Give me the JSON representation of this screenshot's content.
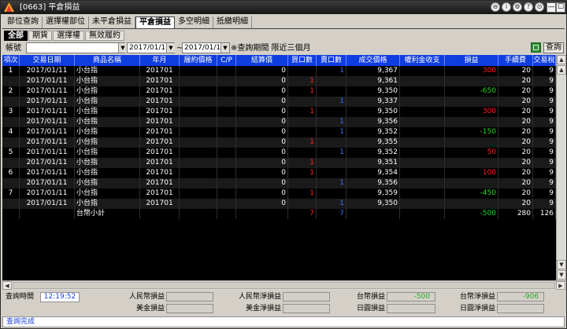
{
  "window": {
    "title": "[0663] 平倉損益",
    "title_buttons": [
      "⊖",
      "i",
      "⚙",
      "?",
      "⊙"
    ],
    "controls": [
      "—",
      "☐",
      "✕"
    ]
  },
  "tabs": [
    {
      "label": "部位查詢",
      "active": false
    },
    {
      "label": "選擇權部位",
      "active": false
    },
    {
      "label": "未平倉損益",
      "active": false
    },
    {
      "label": "平倉損益",
      "active": true
    },
    {
      "label": "多空明細",
      "active": false
    },
    {
      "label": "抵繳明細",
      "active": false
    }
  ],
  "subtabs": [
    {
      "label": "全部",
      "active": true
    },
    {
      "label": "期貨",
      "active": false
    },
    {
      "label": "選擇權",
      "active": false
    },
    {
      "label": "無效履約",
      "active": false
    }
  ],
  "filter": {
    "account_label": "帳號",
    "account_value": "",
    "date_from": "2017/01/11",
    "date_to": "2017/01/11",
    "tilde": "~",
    "note": "※查詢期間 限近三個月",
    "query_button": "查詢"
  },
  "grid": {
    "columns": [
      "項次",
      "交易日期",
      "商品名稱",
      "年月",
      "履約價格",
      "C/P",
      "結算價",
      "買口數",
      "賣口數",
      "成交價格",
      "權利金收支",
      "損益",
      "手續費",
      "交易稅"
    ],
    "rows": [
      {
        "idx": "1",
        "date": "2017/01/11",
        "name": "小台指",
        "ym": "201701",
        "strike": "",
        "cp": "",
        "settle": "0",
        "buy": "",
        "sell": "1",
        "price": "9,367",
        "premium": "",
        "pnl": "300",
        "pnl_color": "#ff2020",
        "fee": "20",
        "tax": "9"
      },
      {
        "idx": "",
        "date": "2017/01/11",
        "name": "小台指",
        "ym": "201701",
        "strike": "",
        "cp": "",
        "settle": "0",
        "buy": "1",
        "sell": "",
        "price": "9,361",
        "premium": "",
        "pnl": "",
        "pnl_color": "#ffffff",
        "fee": "20",
        "tax": "9"
      },
      {
        "idx": "2",
        "date": "2017/01/11",
        "name": "小台指",
        "ym": "201701",
        "strike": "",
        "cp": "",
        "settle": "0",
        "buy": "1",
        "sell": "",
        "price": "9,350",
        "premium": "",
        "pnl": "-650",
        "pnl_color": "#22dd22",
        "fee": "20",
        "tax": "9"
      },
      {
        "idx": "",
        "date": "2017/01/11",
        "name": "小台指",
        "ym": "201701",
        "strike": "",
        "cp": "",
        "settle": "0",
        "buy": "",
        "sell": "1",
        "price": "9,337",
        "premium": "",
        "pnl": "",
        "pnl_color": "#ffffff",
        "fee": "20",
        "tax": "9"
      },
      {
        "idx": "3",
        "date": "2017/01/11",
        "name": "小台指",
        "ym": "201701",
        "strike": "",
        "cp": "",
        "settle": "0",
        "buy": "1",
        "sell": "",
        "price": "9,350",
        "premium": "",
        "pnl": "300",
        "pnl_color": "#ff2020",
        "fee": "20",
        "tax": "9"
      },
      {
        "idx": "",
        "date": "2017/01/11",
        "name": "小台指",
        "ym": "201701",
        "strike": "",
        "cp": "",
        "settle": "0",
        "buy": "",
        "sell": "1",
        "price": "9,356",
        "premium": "",
        "pnl": "",
        "pnl_color": "#ffffff",
        "fee": "20",
        "tax": "9"
      },
      {
        "idx": "4",
        "date": "2017/01/11",
        "name": "小台指",
        "ym": "201701",
        "strike": "",
        "cp": "",
        "settle": "0",
        "buy": "",
        "sell": "1",
        "price": "9,352",
        "premium": "",
        "pnl": "-150",
        "pnl_color": "#22dd22",
        "fee": "20",
        "tax": "9"
      },
      {
        "idx": "",
        "date": "2017/01/11",
        "name": "小台指",
        "ym": "201701",
        "strike": "",
        "cp": "",
        "settle": "0",
        "buy": "1",
        "sell": "",
        "price": "9,355",
        "premium": "",
        "pnl": "",
        "pnl_color": "#ffffff",
        "fee": "20",
        "tax": "9"
      },
      {
        "idx": "5",
        "date": "2017/01/11",
        "name": "小台指",
        "ym": "201701",
        "strike": "",
        "cp": "",
        "settle": "0",
        "buy": "",
        "sell": "1",
        "price": "9,352",
        "premium": "",
        "pnl": "50",
        "pnl_color": "#ff2020",
        "fee": "20",
        "tax": "9"
      },
      {
        "idx": "",
        "date": "2017/01/11",
        "name": "小台指",
        "ym": "201701",
        "strike": "",
        "cp": "",
        "settle": "0",
        "buy": "1",
        "sell": "",
        "price": "9,351",
        "premium": "",
        "pnl": "",
        "pnl_color": "#ffffff",
        "fee": "20",
        "tax": "9"
      },
      {
        "idx": "6",
        "date": "2017/01/11",
        "name": "小台指",
        "ym": "201701",
        "strike": "",
        "cp": "",
        "settle": "0",
        "buy": "1",
        "sell": "",
        "price": "9,354",
        "premium": "",
        "pnl": "100",
        "pnl_color": "#ff2020",
        "fee": "20",
        "tax": "9"
      },
      {
        "idx": "",
        "date": "2017/01/11",
        "name": "小台指",
        "ym": "201701",
        "strike": "",
        "cp": "",
        "settle": "0",
        "buy": "",
        "sell": "1",
        "price": "9,356",
        "premium": "",
        "pnl": "",
        "pnl_color": "#ffffff",
        "fee": "20",
        "tax": "9"
      },
      {
        "idx": "7",
        "date": "2017/01/11",
        "name": "小台指",
        "ym": "201701",
        "strike": "",
        "cp": "",
        "settle": "0",
        "buy": "1",
        "sell": "",
        "price": "9,359",
        "premium": "",
        "pnl": "-450",
        "pnl_color": "#22dd22",
        "fee": "20",
        "tax": "9"
      },
      {
        "idx": "",
        "date": "2017/01/11",
        "name": "小台指",
        "ym": "201701",
        "strike": "",
        "cp": "",
        "settle": "0",
        "buy": "",
        "sell": "1",
        "price": "9,350",
        "premium": "",
        "pnl": "",
        "pnl_color": "#ffffff",
        "fee": "20",
        "tax": "9"
      },
      {
        "idx": "",
        "date": "",
        "name": "台幣小計",
        "ym": "",
        "strike": "",
        "cp": "",
        "settle": "",
        "buy": "7",
        "sell": "7",
        "price": "",
        "premium": "",
        "pnl": "-500",
        "pnl_color": "#22dd22",
        "fee": "280",
        "tax": "126"
      }
    ]
  },
  "summary": {
    "query_time_label": "查詢時間",
    "query_time_value": "12:19:52",
    "rmb_pnl_label": "人民幣損益",
    "rmb_pnl_value": "",
    "rmb_net_label": "人民幣淨損益",
    "rmb_net_value": "",
    "twd_pnl_label": "台幣損益",
    "twd_pnl_value": "-500",
    "twd_net_label": "台幣淨損益",
    "twd_net_value": "-906",
    "usd_pnl_label": "美金損益",
    "usd_pnl_value": "",
    "usd_net_label": "美金淨損益",
    "usd_net_value": "",
    "jpy_pnl_label": "日圓損益",
    "jpy_pnl_value": "",
    "jpy_net_label": "日圓淨損益",
    "jpy_net_value": ""
  },
  "status": {
    "text": "查詢完成"
  },
  "colors": {
    "title_bar": "#1e1e1e",
    "grid_header": "#0f3ee0",
    "grid_bg": "#000000",
    "buy_color": "#ff2020",
    "sell_color": "#3a6cff",
    "profit": "#ff2020",
    "loss": "#22dd22",
    "status_text": "#1a3ee0"
  }
}
